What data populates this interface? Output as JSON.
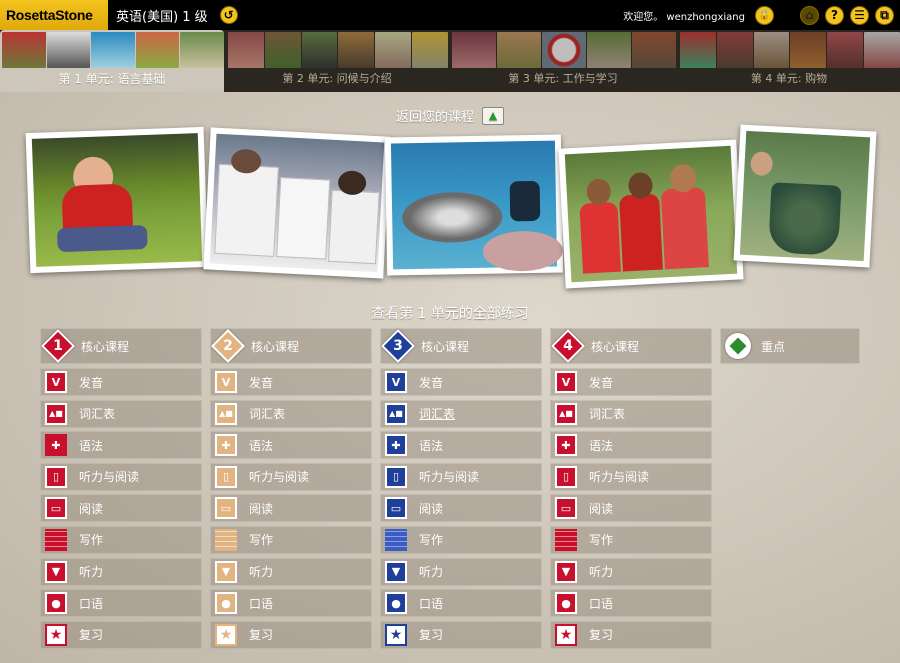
{
  "topbar": {
    "logo": "RosettaStone",
    "course_title": "英语(美国) 1 级",
    "back_glyph": "↺",
    "welcome": "欢迎您。  wenzhongxiang",
    "icons": [
      "lock-icon",
      "home-icon",
      "help-icon",
      "settings-icon",
      "window-icon"
    ],
    "glyphs": {
      "lock": "🔒",
      "home": "⌂",
      "help": "?",
      "settings": "☰",
      "window": "⧉"
    }
  },
  "units": [
    {
      "label": "第 1 单元: 语言基础",
      "active": true
    },
    {
      "label": "第 2 单元: 问候与介绍",
      "active": false
    },
    {
      "label": "第 3 单元: 工作与学习",
      "active": false
    },
    {
      "label": "第 4 单元: 购物",
      "active": false
    }
  ],
  "return_label": "返回您的课程",
  "section_title": "查看第 1 单元的全部练习",
  "colors": {
    "red": "#c8102e",
    "tan": "#e2b481",
    "blue": "#1f3f9a"
  },
  "lessons": [
    {
      "number": "1",
      "color": "#c8102e",
      "title": "核心课程"
    },
    {
      "number": "2",
      "color": "#e2b481",
      "title": "核心课程"
    },
    {
      "number": "3",
      "color": "#1f3f9a",
      "title": "核心课程"
    },
    {
      "number": "4",
      "color": "#c8102e",
      "title": "核心课程"
    }
  ],
  "activities": [
    {
      "key": "pronunciation",
      "label": "发音",
      "icon": "mouth-icon",
      "glyph": "V"
    },
    {
      "key": "vocabulary",
      "label": "词汇表",
      "icon": "shapes-icon",
      "glyph": "▲■"
    },
    {
      "key": "grammar",
      "label": "语法",
      "icon": "plus-icon",
      "glyph": "✚"
    },
    {
      "key": "listen_read",
      "label": "听力与阅读",
      "icon": "page-speaker-icon",
      "glyph": "▯"
    },
    {
      "key": "reading",
      "label": "阅读",
      "icon": "book-icon",
      "glyph": "▭"
    },
    {
      "key": "writing",
      "label": "写作",
      "icon": "bricks-icon",
      "glyph": "▦"
    },
    {
      "key": "listening",
      "label": "听力",
      "icon": "ear-icon",
      "glyph": "▼"
    },
    {
      "key": "speaking",
      "label": "口语",
      "icon": "speech-bubble-icon",
      "glyph": "●"
    },
    {
      "key": "review",
      "label": "复习",
      "icon": "star-icon",
      "glyph": "★"
    }
  ],
  "focus": {
    "label": "重点"
  }
}
